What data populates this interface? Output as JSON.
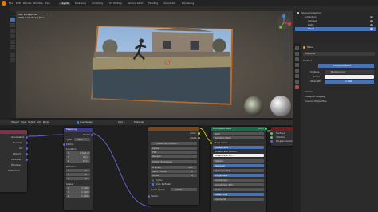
{
  "menu": {
    "items": [
      "File",
      "Edit",
      "Render",
      "Window",
      "Help"
    ],
    "workspace_tabs": [
      "Layout",
      "Modeling",
      "Sculpting",
      "UV Editing",
      "Texture Paint",
      "Shading",
      "Animation",
      "Rendering"
    ]
  },
  "viewport": {
    "view_name": "User Perspective",
    "collection_path": "(984) Collection | Plane"
  },
  "outliner": {
    "title": "Scene Collection",
    "items": [
      "Collection",
      "Camera",
      "Light",
      "Plane"
    ]
  },
  "properties": {
    "object_name": "Plane",
    "material_name": "Material",
    "surface_header": "Surface",
    "surface_value": "Principled BSDF",
    "background_label": "Surface",
    "background_value": "Background",
    "color_label": "Color",
    "strength_label": "Strength",
    "strength_value": "1.000",
    "sections": [
      "Volume",
      "Viewport Display",
      "Custom Properties"
    ]
  },
  "node_editor": {
    "header_items": [
      "Object",
      "View",
      "Select",
      "Add",
      "Node"
    ],
    "slot_label": "Slot 1",
    "material_label": "Material",
    "use_nodes": "Use Nodes",
    "mapping": {
      "title": "Mapping",
      "vector_out": "Vector",
      "type_label": "Type",
      "type_value": "Point",
      "vector_in": "Vector",
      "location": "Location",
      "rotation": "Rotation",
      "scale": "Scale",
      "x": "X",
      "y": "Y",
      "z": "Z",
      "loc_x": "0.025 m",
      "loc_y": "0 m",
      "loc_z": "0 m",
      "rot_x": "0°",
      "rot_y": "0°",
      "rot_z": "0°",
      "scale_x": "1.000",
      "scale_y": "1.000",
      "scale_z": "1.000"
    },
    "texcoord": {
      "title": "Texture Coordinate",
      "outputs": [
        "Generated",
        "Normal",
        "UV",
        "Object",
        "Camera",
        "Window",
        "Reflection"
      ]
    },
    "image": {
      "title": "Image Texture",
      "outputs": [
        "Color",
        "Alpha"
      ],
      "file": "action animation...",
      "interp": "Linear",
      "proj": "Flat",
      "ext": "Repeat",
      "source": "Image Sequence",
      "frames_label": "Frames",
      "frames_value": "113",
      "start_label": "Start Frame",
      "start_value": "1",
      "offset_label": "Offset",
      "offset_value": "0",
      "cyclic": "Cyclic",
      "auto_refresh": "Auto Refresh",
      "color_space_label": "Color Space",
      "color_space_value": "sRGB",
      "vector_in": "Vector"
    },
    "bsdf": {
      "title": "Principled BSDF",
      "out": "BSDF",
      "ggx": "GGX",
      "random_walk": "Random Walk",
      "base_color": "Base Color",
      "inputs": [
        "Subsurface",
        "Subsurface Radius",
        "Subsurface Co...",
        "Metallic",
        "Specular",
        "Specular Tint",
        "Roughness",
        "Anisotropic",
        "Anisotropic Rot...",
        "Sheen",
        "Sheen Tint",
        "Clearcoat"
      ]
    },
    "output": {
      "title": "Material Output",
      "inputs": [
        "Surface",
        "Volume",
        "Displacement"
      ],
      "target": "All"
    }
  },
  "colors": {
    "accent": "#4772b3",
    "blender_orange": "#e87d0d",
    "node_input_header": "#83314a",
    "node_vector_header": "#3c3c83",
    "node_texture_header": "#79461d",
    "node_shader_header": "#1b6b4a",
    "node_output_header": "#6e1f1f"
  }
}
